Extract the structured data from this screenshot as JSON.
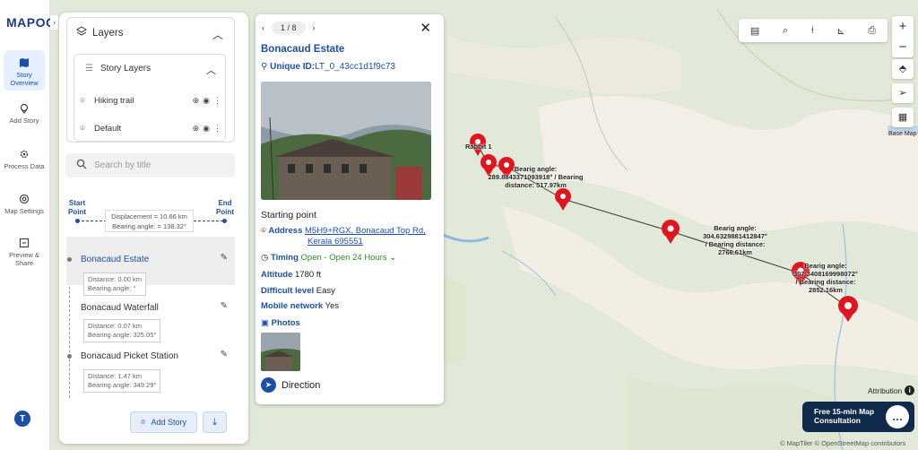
{
  "app": {
    "logo_text": "MAPOG"
  },
  "rail": {
    "items": [
      {
        "label": "Story Overview",
        "icon": "map-icon",
        "active": true
      },
      {
        "label": "Add Story",
        "icon": "pin-icon"
      },
      {
        "label": "Process Data",
        "icon": "gear-icon"
      },
      {
        "label": "Map Settings",
        "icon": "settings-icon"
      },
      {
        "label": "Preview & Share",
        "icon": "share-icon"
      }
    ],
    "avatar_initial": "T"
  },
  "layers": {
    "title": "Layers",
    "story_layers_title": "Story Layers",
    "items": [
      {
        "label": "Hiking trail"
      },
      {
        "label": "Default"
      }
    ]
  },
  "search": {
    "placeholder": "Search by title"
  },
  "story_path": {
    "start_label": "Start Point",
    "end_label": "End Point",
    "displacement": "Displacement = 10.66 km",
    "bearing": "Bearing angle: = 138.32°"
  },
  "stops": [
    {
      "title": "Bonacaud Estate",
      "distance": "Distance: 0.00 km",
      "bearing": "Bearing angle: °",
      "active": true
    },
    {
      "title": "Bonacaud Waterfall",
      "distance": "Distance: 0.07 km",
      "bearing": "Bearing angle: 325.05°"
    },
    {
      "title": "Bonacaud Picket Station",
      "distance": "Distance: 1.47 km",
      "bearing": "Bearing angle: 349.29°"
    }
  ],
  "buttons": {
    "add_story": "Add Story"
  },
  "card": {
    "pager": "1 / 8",
    "title": "Bonacaud Estate",
    "uid_label": "Unique ID:",
    "uid_value": "LT_0_43cc1d1f9c73",
    "description": "Starting point",
    "address_label": "Address",
    "address_line1": "M5H9+RGX, Bonacaud Top Rd,",
    "address_line2": "Kerala 695551",
    "timing_label": "Timing",
    "timing_value": "Open - Open 24 Hours",
    "altitude_label": "Altitude",
    "altitude_value": "1780 ft",
    "difficulty_label": "Difficult level",
    "difficulty_value": "Easy",
    "network_label": "Mobile network",
    "network_value": "Yes",
    "photos_label": "Photos",
    "direction_label": "Direction"
  },
  "map": {
    "basemap_label": "Base Map",
    "attribution_label": "Attribution",
    "consult_line1": "Free 15-min Map",
    "consult_line2": "Consultation",
    "credit": "© MapTiler © OpenStreetMap contributors",
    "labels": {
      "start": "Rabbit 1",
      "seg1_line1": "Bearig angle:",
      "seg1_line2": "289.8843371093918°  / Bearing",
      "seg1_line3": "distance: 517.97km",
      "seg2_line1": "Bearig angle:",
      "seg2_line2": "304.6329881412847°",
      "seg2_line3": "/ Bearing distance:",
      "seg2_line4": "2766.61km",
      "seg3_line1": "Bearig angle:",
      "seg3_line2": "307.3408169998072°",
      "seg3_line3": "/ Bearing distance:",
      "seg3_line4": "2852.16km"
    }
  },
  "colors": {
    "accent": "#1e4fa8",
    "marker": "#e0151f",
    "consult_bg": "#102a4c"
  }
}
